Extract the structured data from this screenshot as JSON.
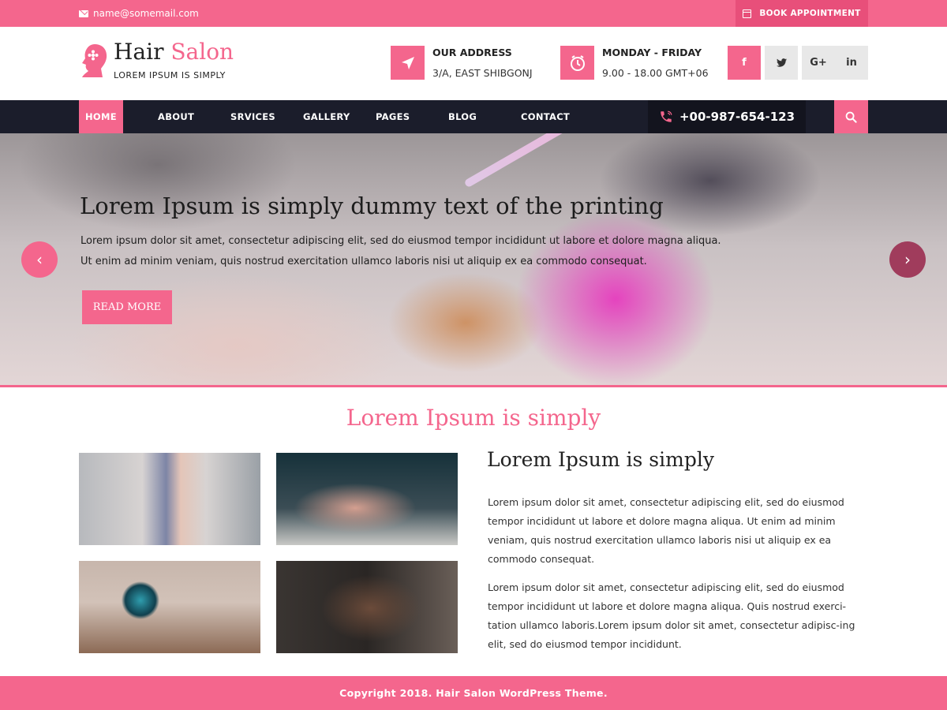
{
  "topbar": {
    "email": "name@somemail.com",
    "book_label": "BOOK APPOINTMENT"
  },
  "header": {
    "logo_word1": "Hair",
    "logo_word2": "Salon",
    "tagline": "LOREM IPSUM IS SIMPLY",
    "address_title": "OUR ADDRESS",
    "address_value": "3/A, EAST SHIBGONJ",
    "hours_title": "MONDAY - FRIDAY",
    "hours_value": "9.00 - 18.00 GMT+06",
    "social": {
      "facebook": "f",
      "twitter": "🐦",
      "googleplus": "G+",
      "linkedin": "in"
    }
  },
  "nav": {
    "items": [
      "HOME",
      "ABOUT",
      "SRVICES",
      "GALLERY",
      "PAGES",
      "BLOG",
      "CONTACT"
    ],
    "phone": "+00-987-654-123"
  },
  "hero": {
    "title": "Lorem Ipsum is simply dummy text of the printing",
    "text": "Lorem ipsum dolor sit amet, consectetur adipiscing elit, sed do eiusmod tempor incididunt ut labore et dolore magna aliqua. Ut enim ad minim veniam, quis nostrud exercitation ullamco laboris nisi ut aliquip ex ea commodo consequat.",
    "button": "READ MORE",
    "prev": "‹",
    "next": "›"
  },
  "about": {
    "section_title": "Lorem Ipsum is simply",
    "title": "Lorem Ipsum is simply",
    "p1": "Lorem ipsum dolor sit amet, consectetur adipiscing elit, sed do eiusmod tempor incididunt ut labore et dolore magna aliqua. Ut enim ad minim veniam, quis nostrud exercitation ullamco laboris nisi ut aliquip ex ea commodo consequat.",
    "p2": "Lorem ipsum dolor sit amet, consectetur adipiscing elit, sed do eiusmod tempor incididunt ut labore et dolore magna aliqua. Quis nostrud exerci-tation ullamco laboris.Lorem ipsum dolor sit amet, consectetur adipisc-ing elit, sed do eiusmod tempor incididunt."
  },
  "footer": {
    "copyright": "Copyright 2018. Hair Salon WordPress Theme."
  },
  "colors": {
    "accent": "#f4668d",
    "nav_bg": "#1b1d2b"
  }
}
